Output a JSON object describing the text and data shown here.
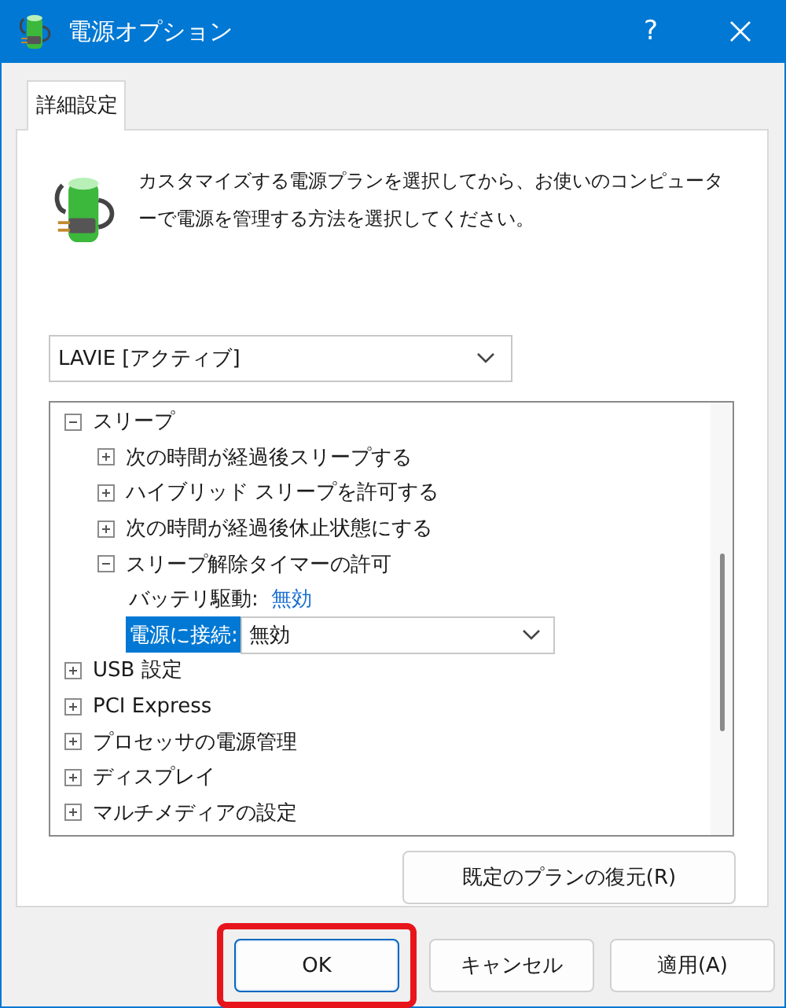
{
  "window": {
    "title": "電源オプション",
    "help": "?"
  },
  "tabs": [
    {
      "label": "詳細設定",
      "selected": true
    }
  ],
  "description": "カスタマイズする電源プランを選択してから、お使いのコンピューターで電源を管理する方法を選択してください。",
  "plan_select": {
    "value": "LAVIE [アクティブ]"
  },
  "tree": [
    {
      "label": "スリープ",
      "expanded": true,
      "children": [
        {
          "label": "次の時間が経過後スリープする",
          "expanded": false
        },
        {
          "label": "ハイブリッド スリープを許可する",
          "expanded": false
        },
        {
          "label": "次の時間が経過後休止状態にする",
          "expanded": false
        },
        {
          "label": "スリープ解除タイマーの許可",
          "expanded": true,
          "children": [
            {
              "kind": "value",
              "label": "バッテリ駆動:",
              "value": "無効",
              "selected": false
            },
            {
              "kind": "select",
              "label": "電源に接続:",
              "value": "無効",
              "selected": true
            }
          ]
        }
      ]
    },
    {
      "label": "USB 設定",
      "expanded": false
    },
    {
      "label": "PCI Express",
      "expanded": false
    },
    {
      "label": "プロセッサの電源管理",
      "expanded": false
    },
    {
      "label": "ディスプレイ",
      "expanded": false
    },
    {
      "label": "マルチメディアの設定",
      "expanded": false
    }
  ],
  "restore_button": "既定のプランの復元(R)",
  "buttons": [
    {
      "label": "OK",
      "default": true,
      "highlighted": true
    },
    {
      "label": "キャンセル",
      "default": false,
      "highlighted": false
    },
    {
      "label": "適用(A)",
      "default": false,
      "highlighted": false
    }
  ]
}
